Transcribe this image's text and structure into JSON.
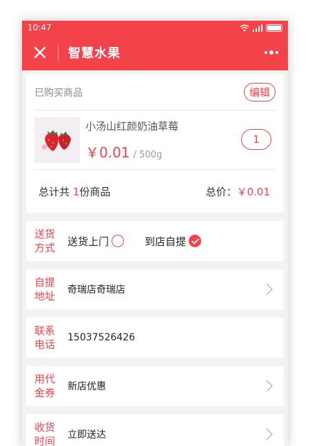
{
  "status_bar": {
    "time": "10:47"
  },
  "header": {
    "title": "智慧水果"
  },
  "order": {
    "section_label": "已购买商品",
    "edit_label": "编辑",
    "product": {
      "name": "小汤山红颜奶油草莓",
      "price": "￥0.01",
      "unit": "/ 500g",
      "quantity": "1"
    },
    "summary": {
      "count_prefix": "总计共 ",
      "count": "1",
      "count_suffix": "份商品",
      "total_label": "总价：",
      "total_value": "￥0.01"
    }
  },
  "delivery": {
    "label": "送货方式",
    "label_line1": "送货",
    "label_line2": "方式",
    "option_home": "送货上门",
    "option_pickup": "到店自提",
    "selected": "到店自提"
  },
  "pickup_address": {
    "label_line1": "自提",
    "label_line2": "地址",
    "value": "奇瑞店奇瑞店"
  },
  "contact_phone": {
    "label_line1": "联系",
    "label_line2": "电话",
    "value": "15037526426"
  },
  "voucher": {
    "label_line1": "用代",
    "label_line2": "金券",
    "value": "新店优惠"
  },
  "delivery_time": {
    "label_line1": "收货",
    "label_line2": "时间",
    "value": "立即送达"
  },
  "colors": {
    "accent": "#f4424a",
    "background": "#f2f2f2"
  }
}
